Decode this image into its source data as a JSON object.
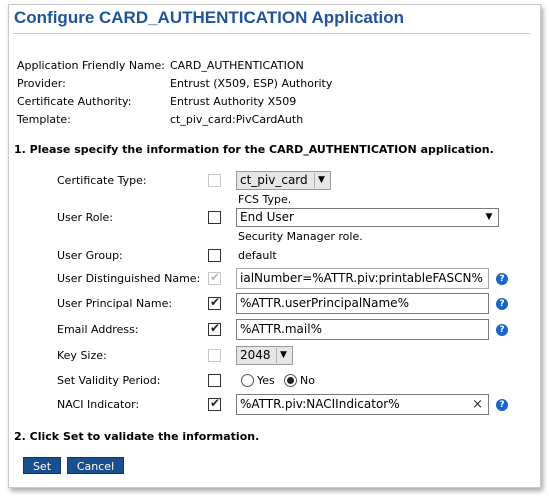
{
  "title": "Configure CARD_AUTHENTICATION Application",
  "info": [
    {
      "label": "Application Friendly Name:",
      "value": "CARD_AUTHENTICATION"
    },
    {
      "label": "Provider:",
      "value": "Entrust (X509, ESP) Authority"
    },
    {
      "label": "Certificate Authority:",
      "value": "Entrust Authority X509"
    },
    {
      "label": "Template:",
      "value": "ct_piv_card:PivCardAuth"
    }
  ],
  "step1": "1. Please specify the information for the CARD_AUTHENTICATION application.",
  "step2": "2. Click Set to validate the information.",
  "fields": {
    "certificate_type": {
      "label": "Certificate Type:",
      "value": "ct_piv_card",
      "hint": "FCS Type.",
      "checked": false,
      "enabled": false
    },
    "user_role": {
      "label": "User Role:",
      "value": "End User",
      "hint": "Security Manager role.",
      "checked": false,
      "enabled": true
    },
    "user_group": {
      "label": "User Group:",
      "value": "default",
      "checked": false,
      "enabled": true
    },
    "user_dn": {
      "label": "User Distinguished Name:",
      "value": "ialNumber=%ATTR.piv:printableFASCN%",
      "checked": true,
      "enabled": false
    },
    "user_principal_name": {
      "label": "User Principal Name:",
      "value": "%ATTR.userPrincipalName%",
      "checked": true,
      "enabled": true
    },
    "email_address": {
      "label": "Email Address:",
      "value": "%ATTR.mail%",
      "checked": true,
      "enabled": true
    },
    "key_size": {
      "label": "Key Size:",
      "value": "2048",
      "checked": false,
      "enabled": false
    },
    "validity_period": {
      "label": "Set Validity Period:",
      "yes_label": "Yes",
      "no_label": "No",
      "selected": "No",
      "checked": false,
      "enabled": true
    },
    "naci_indicator": {
      "label": "NACI Indicator:",
      "value": "%ATTR.piv:NACIIndicator%",
      "checked": true,
      "enabled": true
    }
  },
  "buttons": {
    "set": "Set",
    "cancel": "Cancel"
  },
  "help_glyph": "?",
  "clear_glyph": "×",
  "dropdown_glyph": "▼",
  "colors": {
    "title": "#1f5598",
    "button": "#1a4f8f",
    "help": "#1a66c9"
  }
}
